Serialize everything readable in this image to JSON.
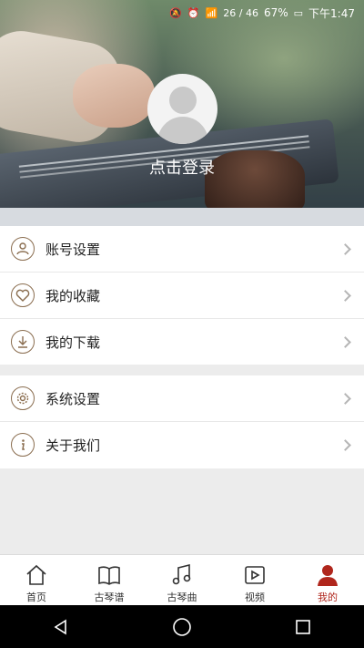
{
  "status": {
    "signal_text": "26 / 46",
    "battery": "67%",
    "time": "下午1:47"
  },
  "profile": {
    "login_text": "点击登录"
  },
  "menu_group1": [
    {
      "label": "账号设置",
      "icon": "account-icon"
    },
    {
      "label": "我的收藏",
      "icon": "heart-icon"
    },
    {
      "label": "我的下载",
      "icon": "download-icon"
    }
  ],
  "menu_group2": [
    {
      "label": "系统设置",
      "icon": "gear-icon"
    },
    {
      "label": "关于我们",
      "icon": "info-icon"
    }
  ],
  "tabs": [
    {
      "label": "首页",
      "icon": "home-icon"
    },
    {
      "label": "古琴谱",
      "icon": "book-icon"
    },
    {
      "label": "古琴曲",
      "icon": "music-note-icon"
    },
    {
      "label": "视频",
      "icon": "video-icon"
    },
    {
      "label": "我的",
      "icon": "person-icon",
      "active": true
    }
  ],
  "colors": {
    "accent": "#b0261c",
    "icon_brown": "#8a6d4f"
  }
}
